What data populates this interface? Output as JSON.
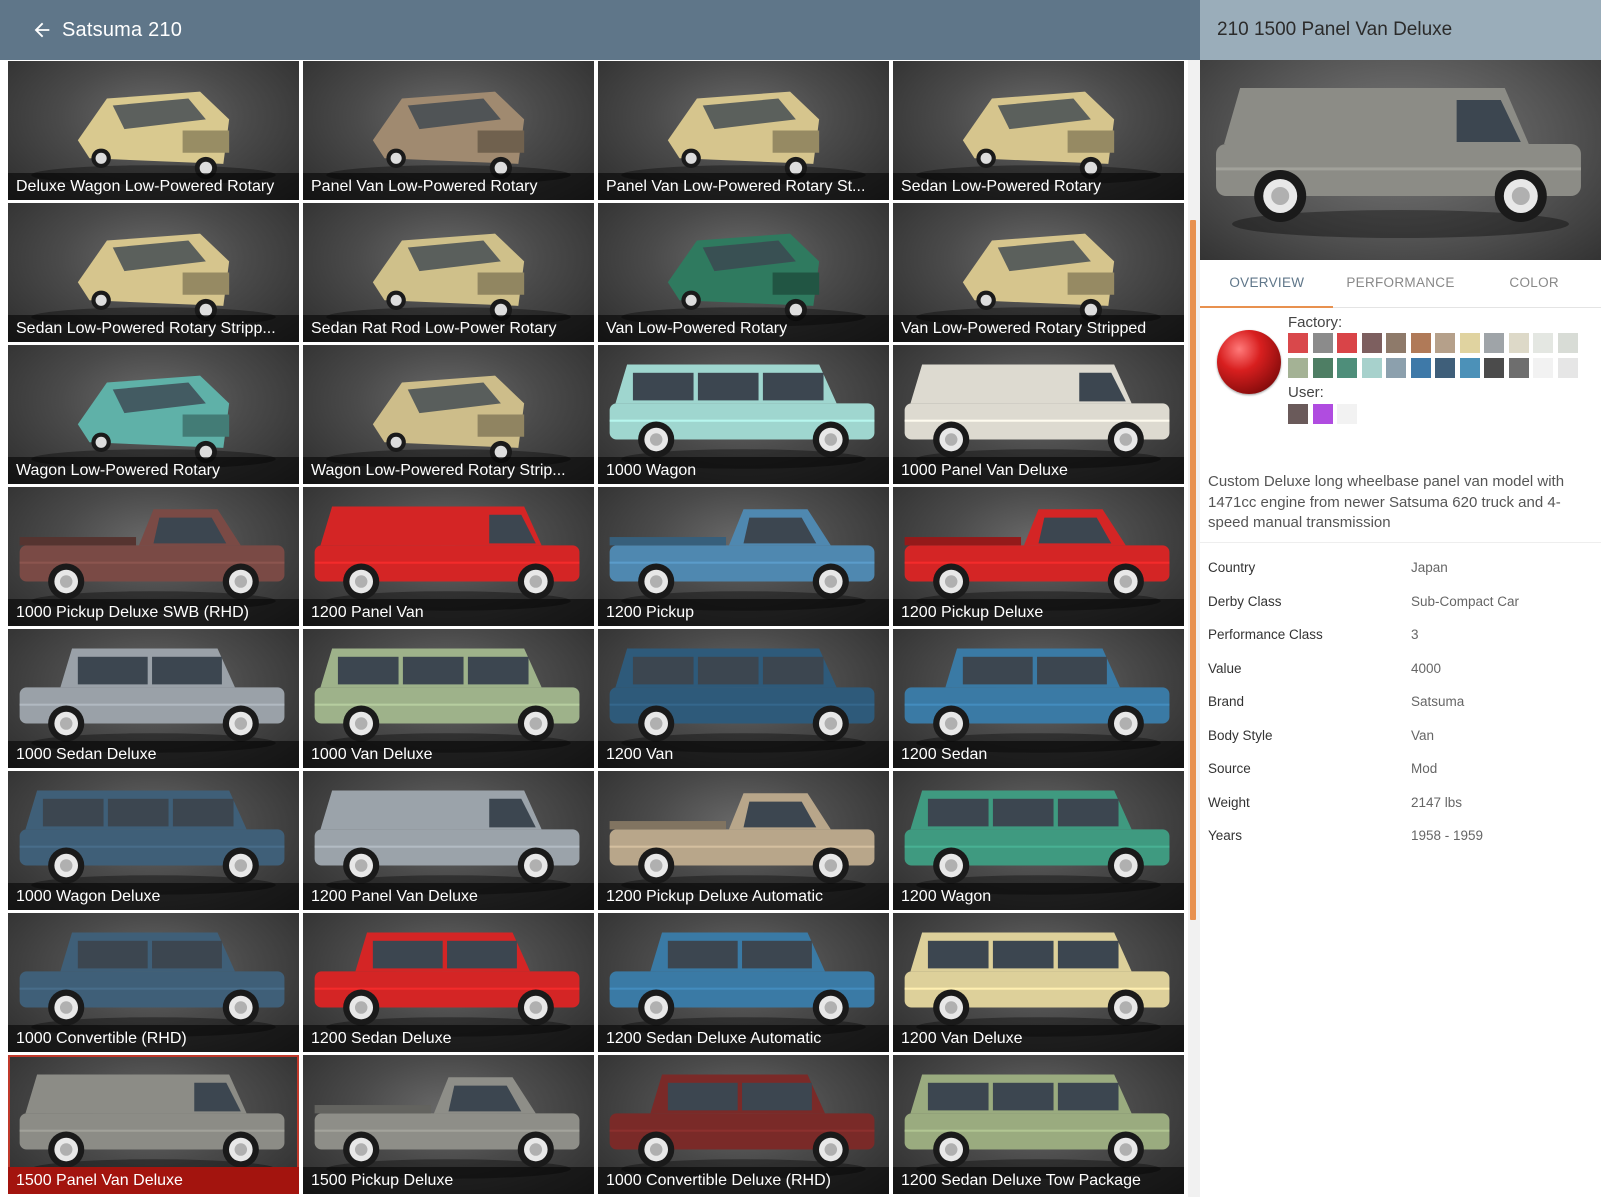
{
  "header": {
    "back_icon": "arrow-left-icon",
    "title": "Satsuma 210"
  },
  "grid": {
    "tiles": [
      {
        "label": "Deluxe Wagon Low-Powered Rotary",
        "color": "#d9c98f",
        "body": "wagon",
        "view": "three-quarter"
      },
      {
        "label": "Panel Van Low-Powered Rotary",
        "color": "#a08a70",
        "body": "van",
        "view": "three-quarter"
      },
      {
        "label": "Panel Van Low-Powered Rotary St...",
        "color": "#d6c58d",
        "body": "van",
        "view": "three-quarter"
      },
      {
        "label": "Sedan Low-Powered Rotary",
        "color": "#d6c58d",
        "body": "sedan",
        "view": "three-quarter"
      },
      {
        "label": "Sedan Low-Powered Rotary Stripp...",
        "color": "#d6c58d",
        "body": "sedan",
        "view": "three-quarter"
      },
      {
        "label": "Sedan Rat Rod Low-Power Rotary",
        "color": "#cfc08a",
        "body": "sedan",
        "view": "three-quarter"
      },
      {
        "label": "Van Low-Powered Rotary",
        "color": "#2f7a5f",
        "body": "wagon",
        "view": "three-quarter"
      },
      {
        "label": "Van Low-Powered Rotary Stripped",
        "color": "#d6c58d",
        "body": "wagon",
        "view": "three-quarter"
      },
      {
        "label": "Wagon Low-Powered Rotary",
        "color": "#5fb1a8",
        "body": "wagon",
        "view": "three-quarter"
      },
      {
        "label": "Wagon Low-Powered Rotary Strip...",
        "color": "#cdbd8a",
        "body": "wagon",
        "view": "three-quarter"
      },
      {
        "label": "1000 Wagon",
        "color": "#9fd6cf",
        "body": "wagon",
        "view": "side"
      },
      {
        "label": "1000 Panel Van Deluxe",
        "color": "#dddad0",
        "body": "van",
        "view": "side"
      },
      {
        "label": "1000 Pickup Deluxe SWB (RHD)",
        "color": "#7a4a45",
        "body": "pickup",
        "view": "side"
      },
      {
        "label": "1200 Panel Van",
        "color": "#d42525",
        "body": "van",
        "view": "side"
      },
      {
        "label": "1200 Pickup",
        "color": "#4f88b0",
        "body": "pickup",
        "view": "side"
      },
      {
        "label": "1200 Pickup Deluxe",
        "color": "#d42525",
        "body": "pickup",
        "view": "side"
      },
      {
        "label": "1000 Sedan Deluxe",
        "color": "#9aa1a8",
        "body": "sedan",
        "view": "side"
      },
      {
        "label": "1000 Van Deluxe",
        "color": "#9eb28a",
        "body": "wagon",
        "view": "side"
      },
      {
        "label": "1200 Van",
        "color": "#2e5a7a",
        "body": "wagon",
        "view": "side"
      },
      {
        "label": "1200 Sedan",
        "color": "#3a7aa5",
        "body": "sedan",
        "view": "side"
      },
      {
        "label": "1000 Wagon Deluxe",
        "color": "#3f5f78",
        "body": "wagon",
        "view": "side"
      },
      {
        "label": "1200 Panel Van Deluxe",
        "color": "#9ba3aa",
        "body": "van",
        "view": "side"
      },
      {
        "label": "1200 Pickup Deluxe Automatic",
        "color": "#b8a68a",
        "body": "pickup",
        "view": "side"
      },
      {
        "label": "1200 Wagon",
        "color": "#3f9a80",
        "body": "wagon",
        "view": "side"
      },
      {
        "label": "1000 Convertible (RHD)",
        "color": "#3f5f78",
        "body": "sedan",
        "view": "side"
      },
      {
        "label": "1200 Sedan Deluxe",
        "color": "#d42525",
        "body": "sedan",
        "view": "side"
      },
      {
        "label": "1200 Sedan Deluxe Automatic",
        "color": "#3a7aa5",
        "body": "sedan",
        "view": "side"
      },
      {
        "label": "1200 Van Deluxe",
        "color": "#ddd09a",
        "body": "wagon",
        "view": "side"
      },
      {
        "label": "1500 Panel Van Deluxe",
        "color": "#8c8c86",
        "body": "van",
        "view": "side",
        "selected": true
      },
      {
        "label": "1500 Pickup Deluxe",
        "color": "#8e8e88",
        "body": "pickup",
        "view": "side"
      },
      {
        "label": "1000 Convertible Deluxe (RHD)",
        "color": "#7a2a28",
        "body": "sedan",
        "view": "side"
      },
      {
        "label": "1200 Sedan Deluxe Tow Package",
        "color": "#9aab7f",
        "body": "wagon",
        "view": "side"
      }
    ]
  },
  "detail": {
    "title": "210 1500 Panel Van Deluxe",
    "preview_color": "#8c8c86",
    "tabs": [
      "OVERVIEW",
      "PERFORMANCE",
      "COLOR"
    ],
    "active_tab": "OVERVIEW",
    "colors": {
      "factory_label": "Factory:",
      "user_label": "User:",
      "current_color": "#d42525",
      "factory": [
        "#d9484b",
        "#8b8b8b",
        "#d94448",
        "#7d5f5f",
        "#8e7a6a",
        "#b07a58",
        "#b5a08a",
        "#e0d3a0",
        "#9fa4a8",
        "#ddd9c8",
        "#e4e7e2",
        "#d8dcd6",
        "#a4b295",
        "#4e7e64",
        "#4e8e7a",
        "#a7d1cc",
        "#8ca0ad",
        "#3e79a8",
        "#3f5f7a",
        "#4c91b8",
        "#4b4b4b",
        "#6e6e6e",
        "#f2f2f2",
        "#e6e6e6"
      ],
      "user": [
        "#6a5a5a",
        "#b04ce0",
        "#f2f2f2"
      ]
    },
    "description": "Custom Deluxe long wheelbase panel van model with 1471cc engine from newer Satsuma 620 truck and 4-speed manual transmission",
    "info": [
      {
        "key": "Country",
        "value": "Japan"
      },
      {
        "key": "Derby Class",
        "value": "Sub-Compact Car"
      },
      {
        "key": "Performance Class",
        "value": "3"
      },
      {
        "key": "Value",
        "value": "4000"
      },
      {
        "key": "Brand",
        "value": "Satsuma"
      },
      {
        "key": "Body Style",
        "value": "Van"
      },
      {
        "key": "Source",
        "value": "Mod"
      },
      {
        "key": "Weight",
        "value": "2147 lbs"
      },
      {
        "key": "Years",
        "value": "1958 - 1959"
      }
    ]
  }
}
